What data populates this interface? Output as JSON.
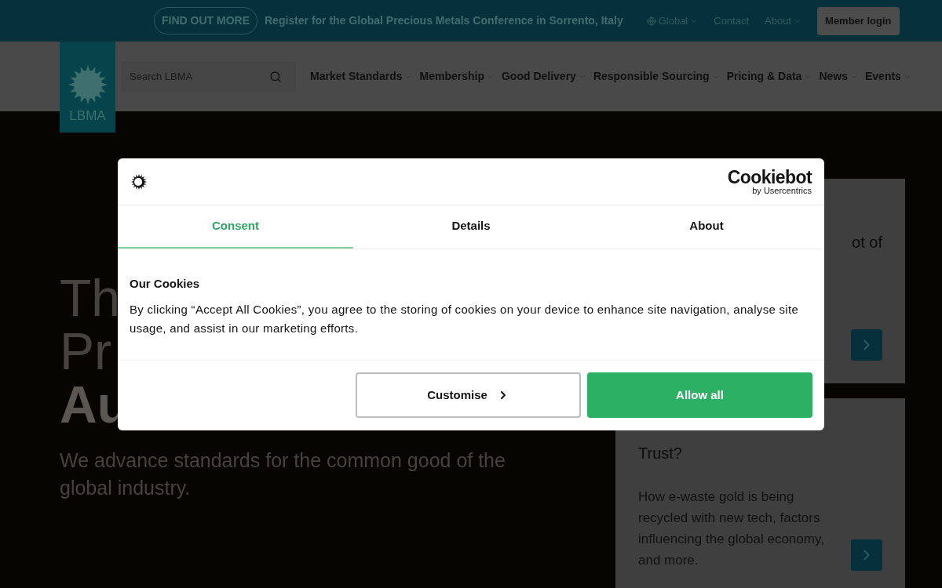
{
  "top_bar": {
    "cta": "FIND OUT MORE",
    "announcement": "Register for the Global Precious Metals Conference in Sorrento, Italy",
    "links": [
      {
        "label": "Global",
        "kind": "region"
      },
      {
        "label": "Contact",
        "kind": "plain"
      },
      {
        "label": "About",
        "kind": "menu"
      }
    ],
    "login": "Member login"
  },
  "header": {
    "logo_text": "LBMA",
    "search": {
      "placeholder": "Search LBMA"
    },
    "nav": [
      {
        "label": "Market Standards"
      },
      {
        "label": "Membership"
      },
      {
        "label": "Good Delivery"
      },
      {
        "label": "Responsible Sourcing"
      },
      {
        "label": "Pricing & Data"
      },
      {
        "label": "News"
      },
      {
        "label": "Events"
      }
    ]
  },
  "hero": {
    "title_lines": [
      {
        "text": "Th",
        "bold": false
      },
      {
        "text": "Pr",
        "bold": false
      },
      {
        "text": "Au",
        "bold": true
      }
    ],
    "subtitle": "We advance standards for the common good of the global industry."
  },
  "cards": [
    {
      "title": "ot of"
    },
    {
      "title": "Trust?",
      "body": "How e-waste gold is being recycled with new tech, factors influencing the global economy, and more."
    }
  ],
  "cookie_dialog": {
    "brand": "Cookiebot",
    "brand_sub": "by Usercentrics",
    "tabs": [
      {
        "label": "Consent",
        "selected": true
      },
      {
        "label": "Details",
        "selected": false
      },
      {
        "label": "About",
        "selected": false
      }
    ],
    "heading": "Our Cookies",
    "text": "By clicking “Accept All Cookies”, you agree to the storing of cookies on your device to enhance site navigation, analyse site usage, and assist in our marketing efforts.",
    "buttons": [
      {
        "label": "Customise",
        "kind": "secondary"
      },
      {
        "label": "Allow all",
        "kind": "primary"
      }
    ]
  }
}
